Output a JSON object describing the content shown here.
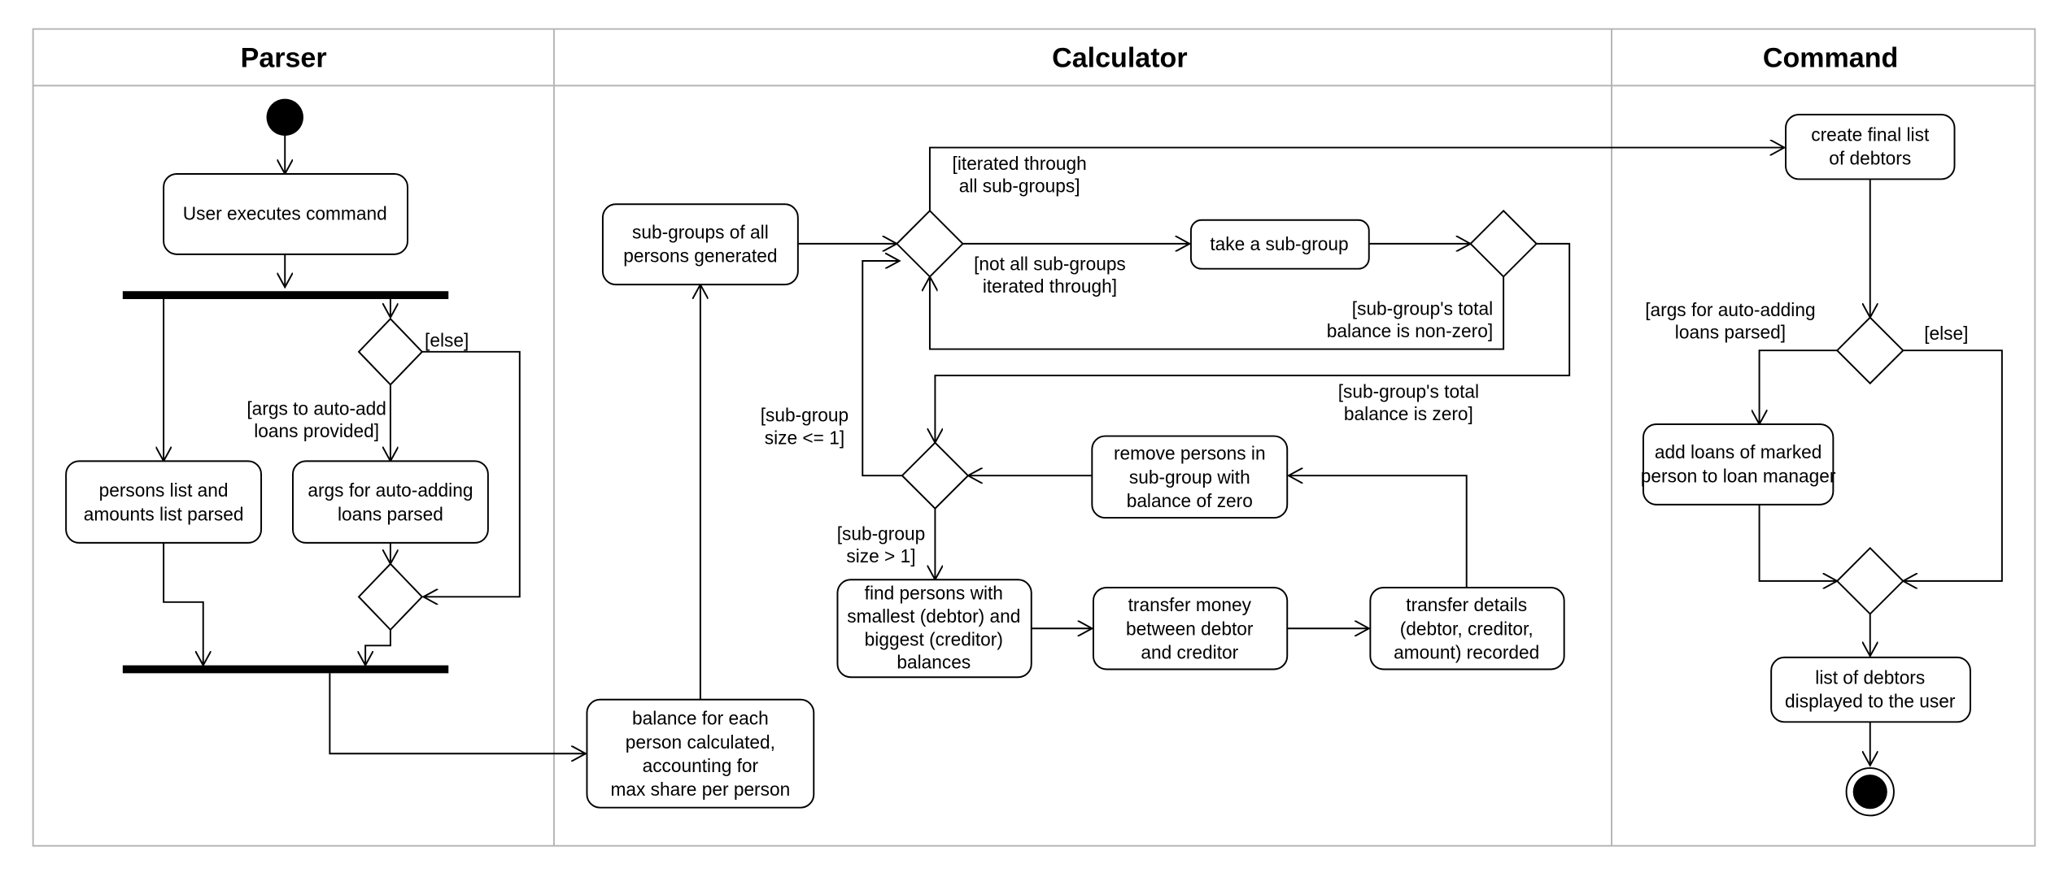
{
  "lanes": {
    "parser": "Parser",
    "calculator": "Calculator",
    "command": "Command"
  },
  "actions": {
    "user_executes": [
      "User executes command"
    ],
    "persons_parsed": [
      "persons list and",
      "amounts list parsed"
    ],
    "args_parsed": [
      "args for auto-adding",
      "loans parsed"
    ],
    "balance_calc": [
      "balance for each",
      "person calculated,",
      "accounting for",
      "max share per person"
    ],
    "subgroups_gen": [
      "sub-groups of all",
      "persons generated"
    ],
    "take_subgroup": [
      "take a sub-group"
    ],
    "remove_persons": [
      "remove persons in",
      "sub-group with",
      "balance of zero"
    ],
    "find_persons": [
      "find persons with",
      "smallest (debtor) and",
      "biggest (creditor)",
      "balances"
    ],
    "transfer_money": [
      "transfer money",
      "between debtor",
      "and creditor"
    ],
    "transfer_details": [
      "transfer details",
      "(debtor, creditor,",
      "amount) recorded"
    ],
    "final_list": [
      "create final list",
      "of debtors"
    ],
    "add_loans": [
      "add loans of marked",
      "person to loan manager"
    ],
    "list_displayed": [
      "list of debtors",
      "displayed to the user"
    ]
  },
  "guards": {
    "else_parser": "[else]",
    "args_provided": [
      "[args to auto-add",
      "loans provided]"
    ],
    "iterated_all": [
      "[iterated through",
      "all sub-groups]"
    ],
    "not_all": [
      "[not all sub-groups",
      "iterated through]"
    ],
    "non_zero": [
      "[sub-group's total",
      "balance is non-zero]"
    ],
    "is_zero": [
      "[sub-group's total",
      "balance is zero]"
    ],
    "size_le1": [
      "[sub-group",
      "size <= 1]"
    ],
    "size_gt1": [
      "[sub-group",
      "size > 1]"
    ],
    "args_parsed_cmd": [
      "[args for auto-adding",
      "loans parsed]"
    ],
    "else_cmd": "[else]"
  }
}
